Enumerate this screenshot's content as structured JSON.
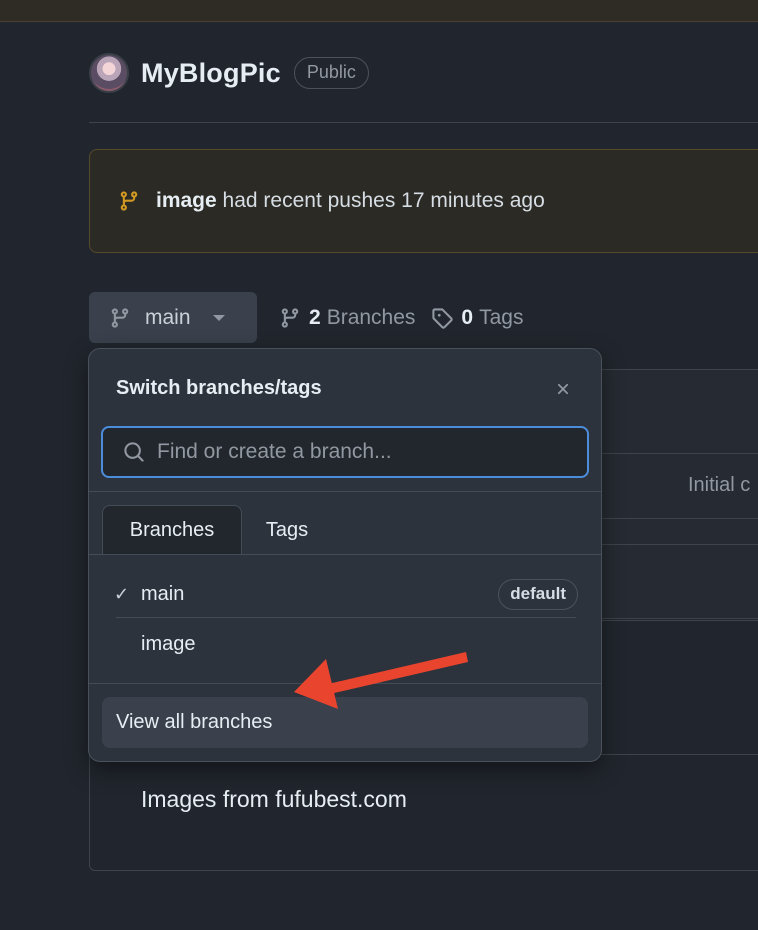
{
  "repo": {
    "name": "MyBlogPic",
    "visibility": "Public"
  },
  "banner": {
    "branch": "image",
    "message": "had recent pushes 17 minutes ago"
  },
  "branch_selector": {
    "current": "main",
    "branch_count": "2",
    "branches_label": "Branches",
    "tag_count": "0",
    "tags_label": "Tags"
  },
  "popover": {
    "title": "Switch branches/tags",
    "search_placeholder": "Find or create a branch...",
    "tabs": [
      "Branches",
      "Tags"
    ],
    "active_tab": "Branches",
    "branches": [
      {
        "name": "main",
        "checked": "✓",
        "badge": "default"
      },
      {
        "name": "image",
        "checked": "",
        "badge": ""
      }
    ],
    "view_all_label": "View all branches"
  },
  "background": {
    "commit_message": "Initial c",
    "readme_text": "Images from fufubest.com"
  },
  "annotation": {
    "arrow_color": "#e8442e"
  }
}
